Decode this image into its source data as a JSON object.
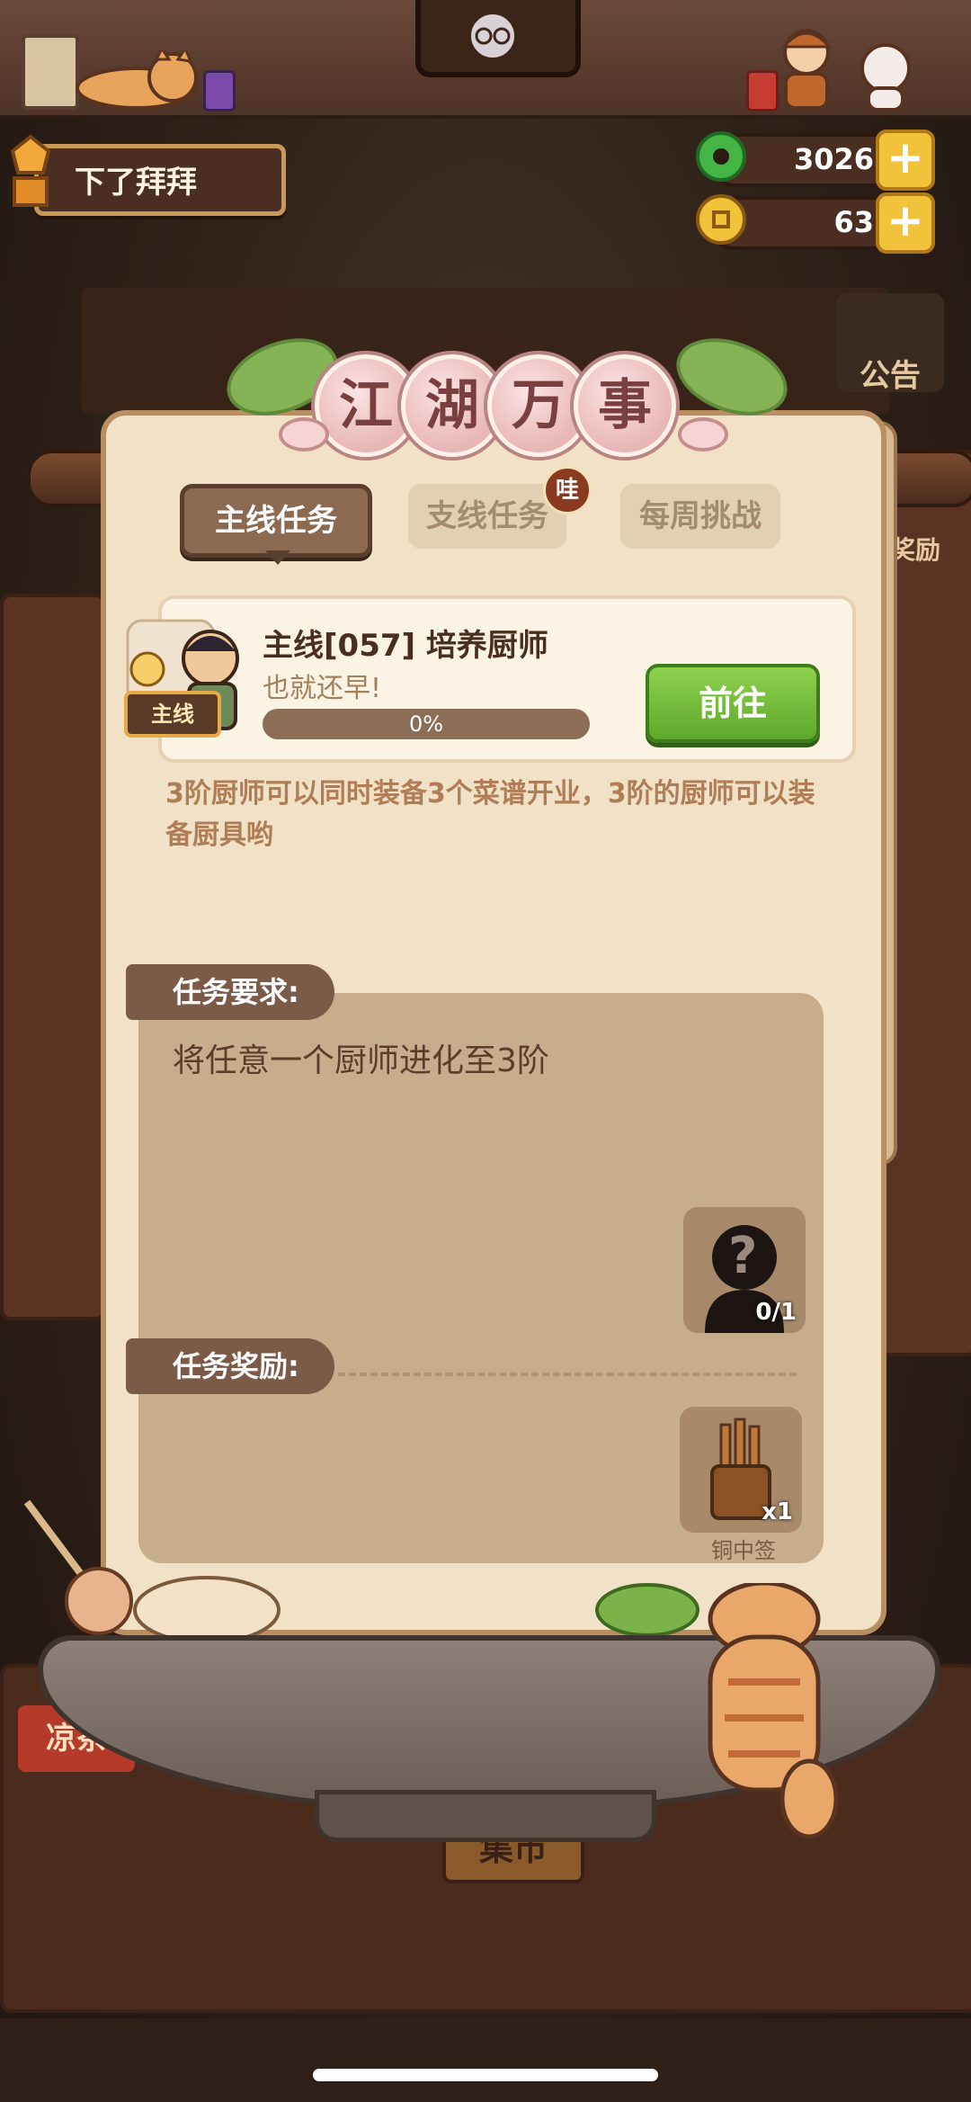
{
  "player": {
    "name": "下了拜拜"
  },
  "currency": {
    "jade": {
      "value": "3026",
      "icon": "jade-coin-icon"
    },
    "gold": {
      "value": "63",
      "icon": "gold-coin-icon"
    },
    "plus": "+"
  },
  "panel": {
    "title_chars": [
      "江",
      "湖",
      "万",
      "事"
    ],
    "tabs": [
      {
        "label": "主线任务",
        "active": true
      },
      {
        "label": "支线任务",
        "active": false,
        "badge": "哇"
      },
      {
        "label": "每周挑战",
        "active": false
      }
    ],
    "task": {
      "tag": "主线",
      "title": "主线[057] 培养厨师",
      "subtitle": "也就还早!",
      "progress": 0,
      "progress_text": "0%",
      "go_label": "前往"
    },
    "description": "3阶厨师可以同时装备3个菜谱开业，3阶的厨师可以装备厨具哟",
    "requirement": {
      "header": "任务要求:",
      "text": "将任意一个厨师进化至3阶",
      "slot_count": "0/1",
      "slot_glyph": "?"
    },
    "reward": {
      "header": "任务奖励:",
      "item_name": "铜中签",
      "item_count": "x1"
    }
  },
  "background": {
    "signs": [
      "公告",
      "凉茶",
      "集市",
      "奖励"
    ]
  },
  "colors": {
    "accent_green": "#6cbd3a",
    "panel_bg": "#f1e1c7",
    "gold": "#f2c23a"
  }
}
